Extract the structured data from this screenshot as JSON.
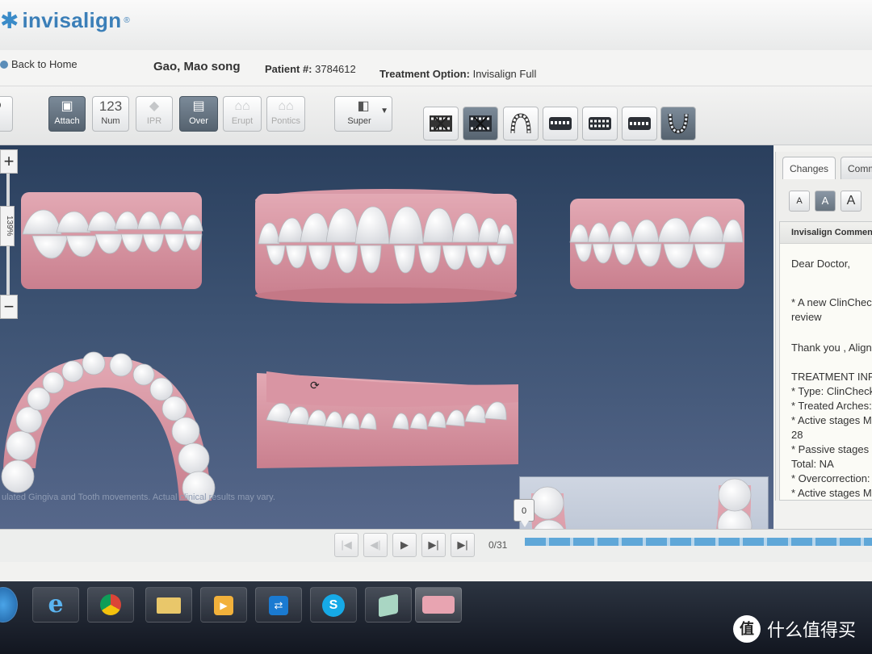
{
  "brand": {
    "name": "invisalign",
    "mark": "®"
  },
  "header": {
    "back_label": "Back to Home",
    "patient_name": "Gao, Mao song",
    "patient_num_label": "Patient #:",
    "patient_num": "3784612",
    "treatment_label": "Treatment Option:",
    "treatment_value": "Invisalign Full"
  },
  "toolbar": {
    "attach": "Attach",
    "num_icon": "123",
    "num": "Num",
    "ipr": "IPR",
    "over": "Over",
    "erupt": "Erupt",
    "pontics": "Pontics",
    "super": "Super"
  },
  "zoom": {
    "level": "139%",
    "plus": "+",
    "minus": "−"
  },
  "viewport": {
    "disclaimer": "ulated Gingiva and Tooth movements. Actual clinical results may vary."
  },
  "panel": {
    "tab_changes": "Changes",
    "tab_comments": "Comm",
    "font_a": "A",
    "header": "Invisalign Commen",
    "lines": [
      "Dear Doctor,",
      "* A new ClinChec",
      "review",
      "Thank you , Align",
      "TREATMENT INF",
      "* Type: ClinCheck",
      "* Treated Arches:",
      "* Active stages M",
      "28",
      "* Passive stages",
      "Total: NA",
      "* Overcorrection:",
      "* Active stages M"
    ]
  },
  "playback": {
    "stage_marker": "0",
    "stage_count": "0/31"
  },
  "watermark": {
    "icon": "值",
    "text": "什么值得买"
  },
  "colors": {
    "brand_blue": "#3b7fb8",
    "viewport_top": "#2a3f5d",
    "gum": "#c98a96",
    "tooth": "#f4f4f2"
  }
}
